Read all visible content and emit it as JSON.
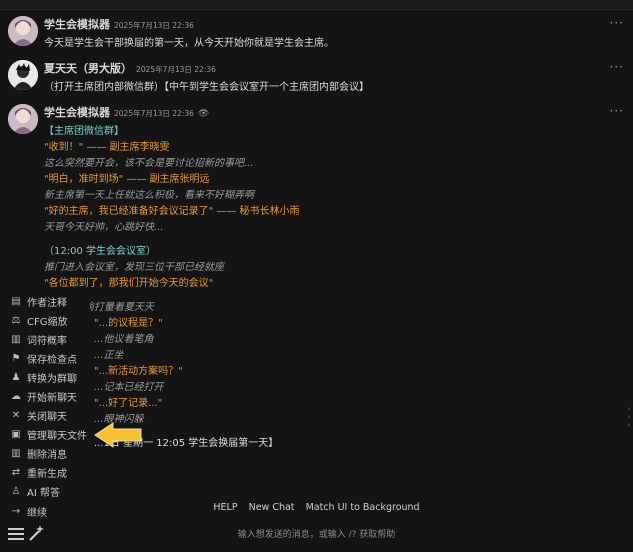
{
  "messages": [
    {
      "name": "学生会模拟器",
      "time": "2025年7月13日 22:36",
      "lines": [
        {
          "style": "normal",
          "text": "今天是学生会干部换届的第一天，从今天开始你就是学生会主席。"
        }
      ]
    },
    {
      "name": "夏天天（男大版）",
      "time": "2025年7月13日 22:36",
      "lines": [
        {
          "style": "normal",
          "text": "（打开主席团内部微信群）【中午到学生会会议室开一个主席团内部会议】"
        }
      ]
    },
    {
      "name": "学生会模拟器",
      "time": "2025年7月13日 22:36",
      "extra": "👁",
      "lines": [
        {
          "style": "title",
          "text": "【主席团微信群】"
        },
        {
          "style": "quote",
          "text": "\"收到！\" —— 副主席李晓雯"
        },
        {
          "style": "ital",
          "text": "这么突然要开会，该不会是要讨论招新的事吧..."
        },
        {
          "style": "quote",
          "text": "\"明白，准时到场\" —— 副主席张明远"
        },
        {
          "style": "ital",
          "text": "新主席第一天上任就这么积极，看来不好糊弄啊"
        },
        {
          "style": "quote",
          "text": "\"好的主席，我已经准备好会议记录了\" —— 秘书长林小雨"
        },
        {
          "style": "ital",
          "text": "天哥今天好帅，心跳好快..."
        },
        {
          "style": "title2",
          "text": "（12:00 学生会会议室）"
        },
        {
          "style": "ital",
          "text": "推门进入会议室，发现三位干部已经就座"
        },
        {
          "style": "quote",
          "text": "\"各位都到了，那我们开始今天的会议\""
        },
        {
          "style": "ital",
          "text": "李晓雯偷偷打量着夏天天"
        },
        {
          "style": "quote",
          "text": "\"...的议程是？\""
        },
        {
          "style": "ital",
          "text": "...他议着笔角"
        },
        {
          "style": "ital",
          "text": "...正坐"
        },
        {
          "style": "quote",
          "text": "\"...新活动方案吗？\""
        },
        {
          "style": "ital",
          "text": "...记本已经打开"
        },
        {
          "style": "quote",
          "text": "\"...好了记录...\""
        },
        {
          "style": "ital",
          "text": "...眼神闪躲"
        },
        {
          "style": "normal",
          "text": "...1日 星期一 12:05 学生会换届第一天】"
        }
      ]
    }
  ],
  "menu": [
    {
      "icon": "note-icon",
      "glyph": "▤",
      "label": "作者注释"
    },
    {
      "icon": "scale-icon",
      "glyph": "⚖",
      "label": "CFG缩放"
    },
    {
      "icon": "probability-icon",
      "glyph": "▥",
      "label": "词符概率"
    },
    {
      "icon": "flag-icon",
      "glyph": "⚑",
      "label": "保存检查点"
    },
    {
      "icon": "group-icon",
      "glyph": "♟",
      "label": "转换为群聊"
    },
    {
      "icon": "chat-icon",
      "glyph": "☁",
      "label": "开始新聊天"
    },
    {
      "icon": "close-icon",
      "glyph": "✕",
      "label": "关闭聊天"
    },
    {
      "icon": "file-icon",
      "glyph": "▣",
      "label": "管理聊天文件"
    },
    {
      "icon": "trash-icon",
      "glyph": "▥",
      "label": "删除消息"
    },
    {
      "icon": "regenerate-icon",
      "glyph": "⇄",
      "label": "重新生成"
    },
    {
      "icon": "robot-icon",
      "glyph": "♙",
      "label": "AI 帮答"
    },
    {
      "icon": "continue-icon",
      "glyph": "→",
      "label": "继续"
    }
  ],
  "bottom_links": {
    "help": "HELP",
    "new_chat": "New Chat",
    "match_ui": "Match UI to Background"
  },
  "input": {
    "placeholder": "输入想发送的消息，或输入 /? 获取帮助"
  },
  "colors": {
    "accent_teal": "#7ad0cf",
    "quote_orange": "#e89a3c",
    "arrow_yellow": "#f5c234"
  }
}
